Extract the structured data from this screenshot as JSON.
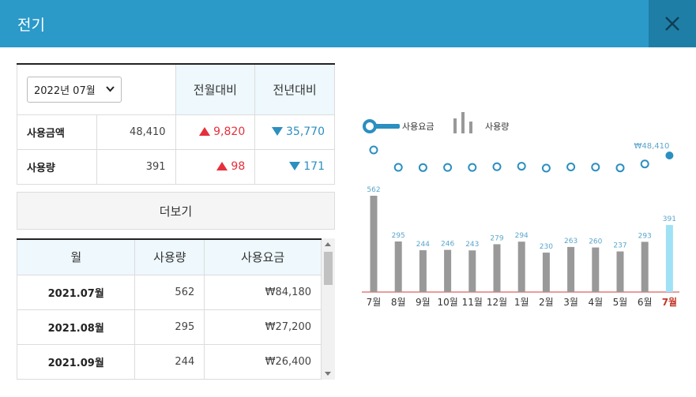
{
  "window": {
    "title": "전기"
  },
  "colors": {
    "header": "#2b9ac9",
    "up": "#e5303b",
    "down": "#2b8fc0",
    "bar": "#999999",
    "bar_current": "#9fe1f5",
    "line": "#2b8fc0"
  },
  "summary": {
    "period_select": "2022년 07월",
    "col_mom": "전월대비",
    "col_yoy": "전년대비",
    "rows": [
      {
        "label": "사용금액",
        "value": "48,410",
        "mom": "9,820",
        "yoy": "35,770"
      },
      {
        "label": "사용량",
        "value": "391",
        "mom": "98",
        "yoy": "171"
      }
    ]
  },
  "more_button": "더보기",
  "history": {
    "headers": [
      "월",
      "사용량",
      "사용요금"
    ],
    "rows": [
      [
        "2021.07월",
        "562",
        "₩84,180"
      ],
      [
        "2021.08월",
        "295",
        "₩27,200"
      ],
      [
        "2021.09월",
        "244",
        "₩26,400"
      ]
    ]
  },
  "chart_data": {
    "type": "bar",
    "legend": {
      "line_label": "사용요금",
      "bar_label": "사용량"
    },
    "categories": [
      "7월",
      "8월",
      "9월",
      "10월",
      "11월",
      "12월",
      "1월",
      "2월",
      "3월",
      "4월",
      "5월",
      "6월",
      "7월"
    ],
    "series": [
      {
        "name": "사용량",
        "values": [
          562,
          295,
          244,
          246,
          243,
          279,
          294,
          230,
          263,
          260,
          237,
          293,
          391
        ]
      },
      {
        "name": "사용요금",
        "values": [
          84180,
          27200,
          26400,
          27000,
          27000,
          29200,
          31000,
          24600,
          28500,
          28000,
          25400,
          38590,
          48410
        ]
      }
    ],
    "current_label": "₩48,410",
    "ylim": [
      0,
      600
    ]
  }
}
